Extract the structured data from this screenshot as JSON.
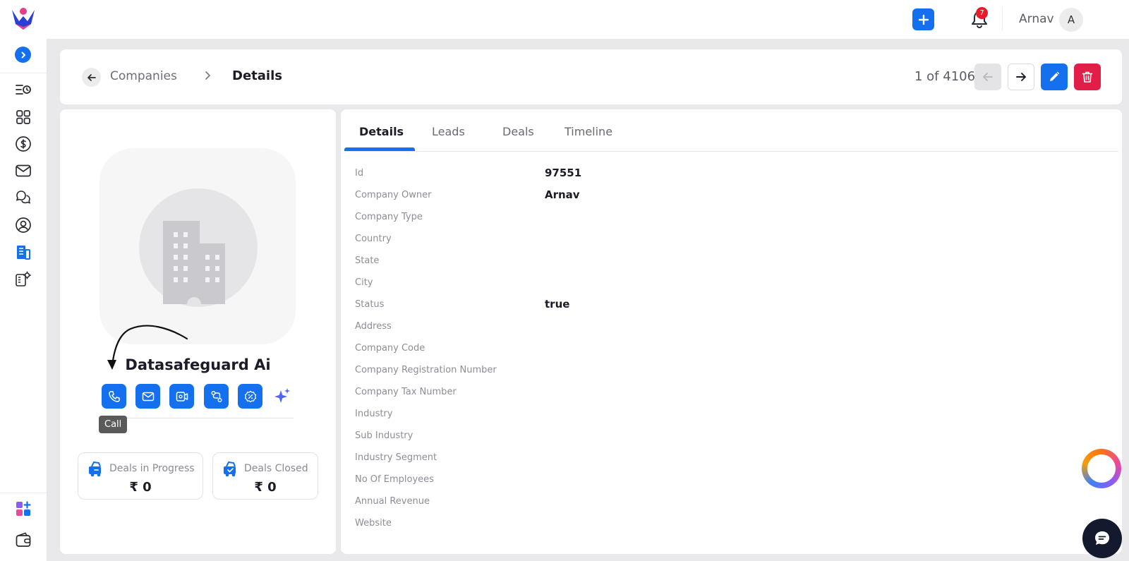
{
  "topbar": {
    "user_name": "Arnav",
    "user_initial": "A",
    "notification_count": "7"
  },
  "breadcrumb": {
    "parent": "Companies",
    "current": "Details"
  },
  "pager": {
    "text": "1 of 4106"
  },
  "company": {
    "name": "Datasafeguard Ai"
  },
  "actions": {
    "tooltip": "Call",
    "icons": [
      "phone-icon",
      "mail-icon",
      "meeting-icon",
      "route-icon",
      "discount-icon",
      "ai-sparkle-icon"
    ]
  },
  "stats": {
    "in_progress_label": "Deals in Progress",
    "in_progress_value": "₹ 0",
    "closed_label": "Deals Closed",
    "closed_value": "₹ 0"
  },
  "tabs": [
    "Details",
    "Leads",
    "Deals",
    "Timeline"
  ],
  "active_tab": "Details",
  "fields": [
    {
      "label": "Id",
      "value": "97551"
    },
    {
      "label": "Company Owner",
      "value": "Arnav"
    },
    {
      "label": "Company Type",
      "value": ""
    },
    {
      "label": "Country",
      "value": ""
    },
    {
      "label": "State",
      "value": ""
    },
    {
      "label": "City",
      "value": ""
    },
    {
      "label": "Status",
      "value": "true"
    },
    {
      "label": "Address",
      "value": ""
    },
    {
      "label": "Company Code",
      "value": ""
    },
    {
      "label": "Company Registration Number",
      "value": ""
    },
    {
      "label": "Company Tax Number",
      "value": ""
    },
    {
      "label": "Industry",
      "value": ""
    },
    {
      "label": "Sub Industry",
      "value": ""
    },
    {
      "label": "Industry Segment",
      "value": ""
    },
    {
      "label": "No Of Employees",
      "value": ""
    },
    {
      "label": "Annual Revenue",
      "value": ""
    },
    {
      "label": "Website",
      "value": ""
    }
  ],
  "colors": {
    "primary": "#1470ef",
    "danger": "#e11d48",
    "badge": "#e81b2b"
  }
}
